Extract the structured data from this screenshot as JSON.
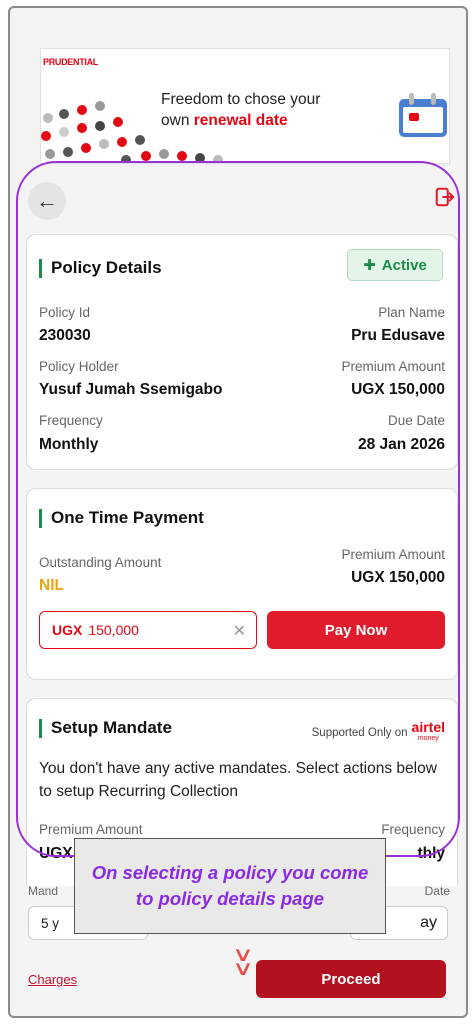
{
  "banner": {
    "brand": "PRUDENTIAL",
    "text_line1": "Freedom to chose your",
    "text_line2_prefix": "own ",
    "text_line2_highlight": "renewal date"
  },
  "header": {
    "back_icon": "arrow-left-icon",
    "logout_icon": "logout-icon"
  },
  "policy_details": {
    "title": "Policy Details",
    "status": "Active",
    "policy_id_label": "Policy Id",
    "policy_id": "230030",
    "plan_name_label": "Plan Name",
    "plan_name": "Pru Edusave",
    "policy_holder_label": "Policy Holder",
    "policy_holder": "Yusuf Jumah Ssemigabo",
    "premium_amount_label": "Premium Amount",
    "premium_amount": "UGX 150,000",
    "frequency_label": "Frequency",
    "frequency": "Monthly",
    "due_date_label": "Due Date",
    "due_date": "28 Jan 2026"
  },
  "one_time_payment": {
    "title": "One Time Payment",
    "outstanding_label": "Outstanding Amount",
    "outstanding_value": "NIL",
    "premium_label": "Premium Amount",
    "premium_value": "UGX 150,000",
    "input_currency": "UGX",
    "input_value": "150,000",
    "clear_icon": "close-icon",
    "pay_button": "Pay Now"
  },
  "setup_mandate": {
    "title": "Setup Mandate",
    "supported_text": "Supported Only on",
    "provider": "airtel",
    "provider_sub": "money",
    "description": "You don't have any active mandates. Select actions below to setup Recurring Collection",
    "premium_label": "Premium Amount",
    "premium_value_partial": "UGX",
    "frequency_label": "Frequency",
    "frequency_value_partial": "thly",
    "mandate_label_partial": "Mand",
    "date_label_partial": "Date",
    "years_value_partial": "5 y",
    "day_value_partial": "ay",
    "charges_link": "Charges",
    "proceed_button": "Proceed"
  },
  "callout": {
    "text": "On selecting a policy you come to policy details page"
  },
  "colors": {
    "brand_red": "#e01b2b",
    "active_green": "#1d8a4a",
    "nil_orange": "#e8a317",
    "outline_purple": "#9b30d9",
    "callout_text": "#8a2be2"
  }
}
